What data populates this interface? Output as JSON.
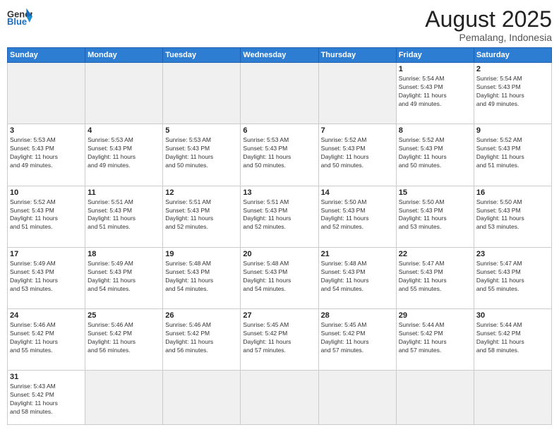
{
  "header": {
    "logo_general": "General",
    "logo_blue": "Blue",
    "month_year": "August 2025",
    "location": "Pemalang, Indonesia"
  },
  "weekdays": [
    "Sunday",
    "Monday",
    "Tuesday",
    "Wednesday",
    "Thursday",
    "Friday",
    "Saturday"
  ],
  "weeks": [
    [
      {
        "day": "",
        "info": ""
      },
      {
        "day": "",
        "info": ""
      },
      {
        "day": "",
        "info": ""
      },
      {
        "day": "",
        "info": ""
      },
      {
        "day": "",
        "info": ""
      },
      {
        "day": "1",
        "info": "Sunrise: 5:54 AM\nSunset: 5:43 PM\nDaylight: 11 hours\nand 49 minutes."
      },
      {
        "day": "2",
        "info": "Sunrise: 5:54 AM\nSunset: 5:43 PM\nDaylight: 11 hours\nand 49 minutes."
      }
    ],
    [
      {
        "day": "3",
        "info": "Sunrise: 5:53 AM\nSunset: 5:43 PM\nDaylight: 11 hours\nand 49 minutes."
      },
      {
        "day": "4",
        "info": "Sunrise: 5:53 AM\nSunset: 5:43 PM\nDaylight: 11 hours\nand 49 minutes."
      },
      {
        "day": "5",
        "info": "Sunrise: 5:53 AM\nSunset: 5:43 PM\nDaylight: 11 hours\nand 50 minutes."
      },
      {
        "day": "6",
        "info": "Sunrise: 5:53 AM\nSunset: 5:43 PM\nDaylight: 11 hours\nand 50 minutes."
      },
      {
        "day": "7",
        "info": "Sunrise: 5:52 AM\nSunset: 5:43 PM\nDaylight: 11 hours\nand 50 minutes."
      },
      {
        "day": "8",
        "info": "Sunrise: 5:52 AM\nSunset: 5:43 PM\nDaylight: 11 hours\nand 50 minutes."
      },
      {
        "day": "9",
        "info": "Sunrise: 5:52 AM\nSunset: 5:43 PM\nDaylight: 11 hours\nand 51 minutes."
      }
    ],
    [
      {
        "day": "10",
        "info": "Sunrise: 5:52 AM\nSunset: 5:43 PM\nDaylight: 11 hours\nand 51 minutes."
      },
      {
        "day": "11",
        "info": "Sunrise: 5:51 AM\nSunset: 5:43 PM\nDaylight: 11 hours\nand 51 minutes."
      },
      {
        "day": "12",
        "info": "Sunrise: 5:51 AM\nSunset: 5:43 PM\nDaylight: 11 hours\nand 52 minutes."
      },
      {
        "day": "13",
        "info": "Sunrise: 5:51 AM\nSunset: 5:43 PM\nDaylight: 11 hours\nand 52 minutes."
      },
      {
        "day": "14",
        "info": "Sunrise: 5:50 AM\nSunset: 5:43 PM\nDaylight: 11 hours\nand 52 minutes."
      },
      {
        "day": "15",
        "info": "Sunrise: 5:50 AM\nSunset: 5:43 PM\nDaylight: 11 hours\nand 53 minutes."
      },
      {
        "day": "16",
        "info": "Sunrise: 5:50 AM\nSunset: 5:43 PM\nDaylight: 11 hours\nand 53 minutes."
      }
    ],
    [
      {
        "day": "17",
        "info": "Sunrise: 5:49 AM\nSunset: 5:43 PM\nDaylight: 11 hours\nand 53 minutes."
      },
      {
        "day": "18",
        "info": "Sunrise: 5:49 AM\nSunset: 5:43 PM\nDaylight: 11 hours\nand 54 minutes."
      },
      {
        "day": "19",
        "info": "Sunrise: 5:48 AM\nSunset: 5:43 PM\nDaylight: 11 hours\nand 54 minutes."
      },
      {
        "day": "20",
        "info": "Sunrise: 5:48 AM\nSunset: 5:43 PM\nDaylight: 11 hours\nand 54 minutes."
      },
      {
        "day": "21",
        "info": "Sunrise: 5:48 AM\nSunset: 5:43 PM\nDaylight: 11 hours\nand 54 minutes."
      },
      {
        "day": "22",
        "info": "Sunrise: 5:47 AM\nSunset: 5:43 PM\nDaylight: 11 hours\nand 55 minutes."
      },
      {
        "day": "23",
        "info": "Sunrise: 5:47 AM\nSunset: 5:43 PM\nDaylight: 11 hours\nand 55 minutes."
      }
    ],
    [
      {
        "day": "24",
        "info": "Sunrise: 5:46 AM\nSunset: 5:42 PM\nDaylight: 11 hours\nand 55 minutes."
      },
      {
        "day": "25",
        "info": "Sunrise: 5:46 AM\nSunset: 5:42 PM\nDaylight: 11 hours\nand 56 minutes."
      },
      {
        "day": "26",
        "info": "Sunrise: 5:46 AM\nSunset: 5:42 PM\nDaylight: 11 hours\nand 56 minutes."
      },
      {
        "day": "27",
        "info": "Sunrise: 5:45 AM\nSunset: 5:42 PM\nDaylight: 11 hours\nand 57 minutes."
      },
      {
        "day": "28",
        "info": "Sunrise: 5:45 AM\nSunset: 5:42 PM\nDaylight: 11 hours\nand 57 minutes."
      },
      {
        "day": "29",
        "info": "Sunrise: 5:44 AM\nSunset: 5:42 PM\nDaylight: 11 hours\nand 57 minutes."
      },
      {
        "day": "30",
        "info": "Sunrise: 5:44 AM\nSunset: 5:42 PM\nDaylight: 11 hours\nand 58 minutes."
      }
    ],
    [
      {
        "day": "31",
        "info": "Sunrise: 5:43 AM\nSunset: 5:42 PM\nDaylight: 11 hours\nand 58 minutes."
      },
      {
        "day": "",
        "info": ""
      },
      {
        "day": "",
        "info": ""
      },
      {
        "day": "",
        "info": ""
      },
      {
        "day": "",
        "info": ""
      },
      {
        "day": "",
        "info": ""
      },
      {
        "day": "",
        "info": ""
      }
    ]
  ]
}
